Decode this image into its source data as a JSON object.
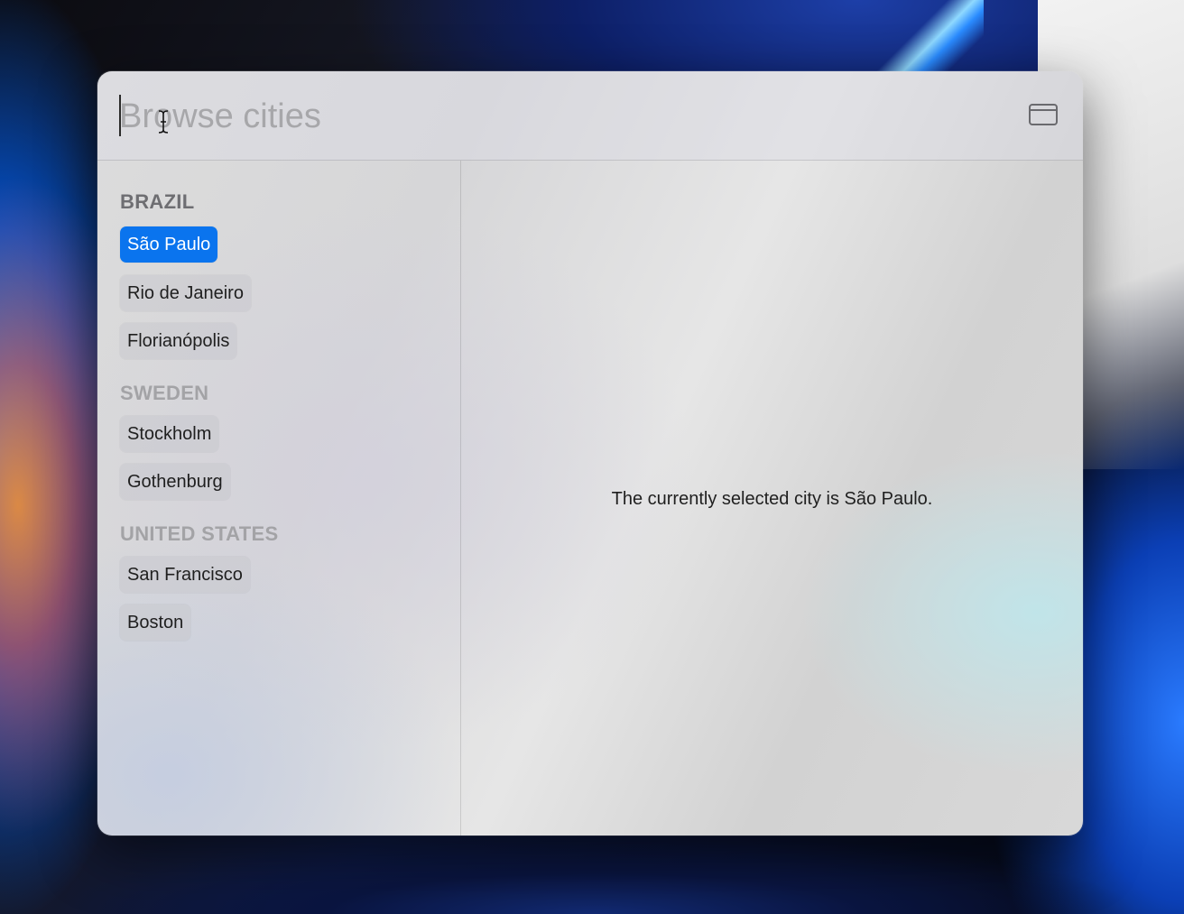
{
  "search": {
    "placeholder": "Browse cities",
    "value": ""
  },
  "toolbar": {
    "toggle_icon": "sidebar-window-icon"
  },
  "sections": [
    {
      "title": "BRAZIL",
      "cities": [
        "São Paulo",
        "Rio de Janeiro",
        "Florianópolis"
      ]
    },
    {
      "title": "SWEDEN",
      "cities": [
        "Stockholm",
        "Gothenburg"
      ]
    },
    {
      "title": "UNITED STATES",
      "cities": [
        "San Francisco",
        "Boston"
      ]
    }
  ],
  "selected_city": "São Paulo",
  "detail": {
    "text": "The currently selected city is São Paulo."
  },
  "colors": {
    "selection": "#0a74ee",
    "section_title": "#a3a3a6",
    "section_title_active": "#6e6e72"
  }
}
